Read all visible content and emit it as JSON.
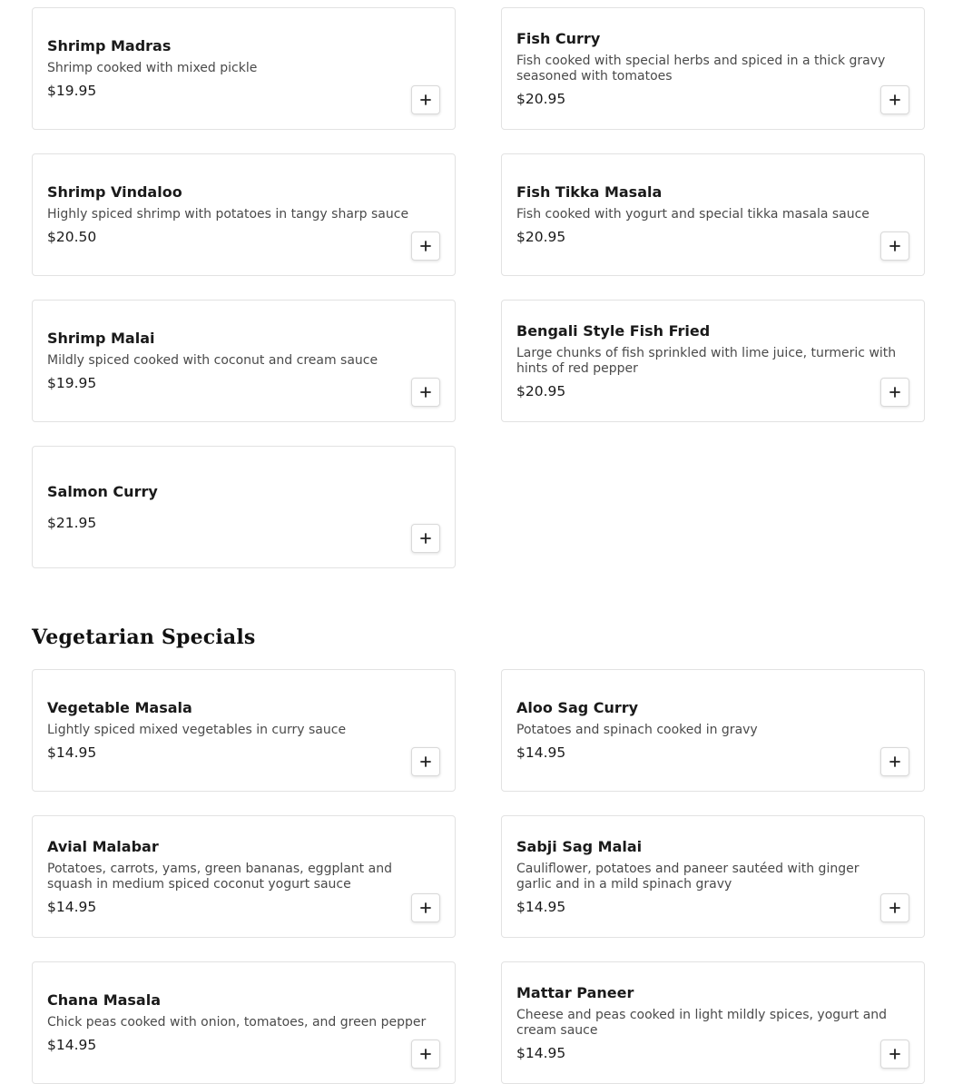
{
  "seafood": {
    "items": [
      {
        "name": "Shrimp Madras",
        "description": "Shrimp cooked with mixed pickle",
        "price": "$19.95"
      },
      {
        "name": "Fish Curry",
        "description": "Fish cooked with special herbs and spiced in a thick gravy seasoned with tomatoes",
        "price": "$20.95"
      },
      {
        "name": "Shrimp Vindaloo",
        "description": "Highly spiced shrimp with potatoes in tangy sharp sauce",
        "price": "$20.50"
      },
      {
        "name": "Fish Tikka Masala",
        "description": "Fish cooked with yogurt and special tikka masala sauce",
        "price": "$20.95"
      },
      {
        "name": "Shrimp Malai",
        "description": "Mildly spiced cooked with coconut and cream sauce",
        "price": "$19.95"
      },
      {
        "name": "Bengali Style Fish Fried",
        "description": "Large chunks of fish sprinkled with lime juice, turmeric with hints of red pepper",
        "price": "$20.95"
      },
      {
        "name": "Salmon Curry",
        "description": "",
        "price": "$21.95"
      }
    ]
  },
  "vegetarian": {
    "title": "Vegetarian Specials",
    "items": [
      {
        "name": "Vegetable Masala",
        "description": "Lightly spiced mixed vegetables in curry sauce",
        "price": "$14.95"
      },
      {
        "name": "Aloo Sag Curry",
        "description": "Potatoes and spinach cooked in gravy",
        "price": "$14.95"
      },
      {
        "name": "Avial Malabar",
        "description": "Potatoes, carrots, yams, green bananas, eggplant and squash in medium spiced coconut yogurt sauce",
        "price": "$14.95"
      },
      {
        "name": "Sabji Sag Malai",
        "description": "Cauliflower, potatoes and paneer sautéed with ginger garlic and in a mild spinach gravy",
        "price": "$14.95"
      },
      {
        "name": "Chana Masala",
        "description": "Chick peas cooked with onion, tomatoes, and green pepper",
        "price": "$14.95"
      },
      {
        "name": "Mattar Paneer",
        "description": "Cheese and peas cooked in light mildly spices, yogurt and cream sauce",
        "price": "$14.95"
      }
    ]
  },
  "icons": {
    "add": "plus-icon"
  }
}
